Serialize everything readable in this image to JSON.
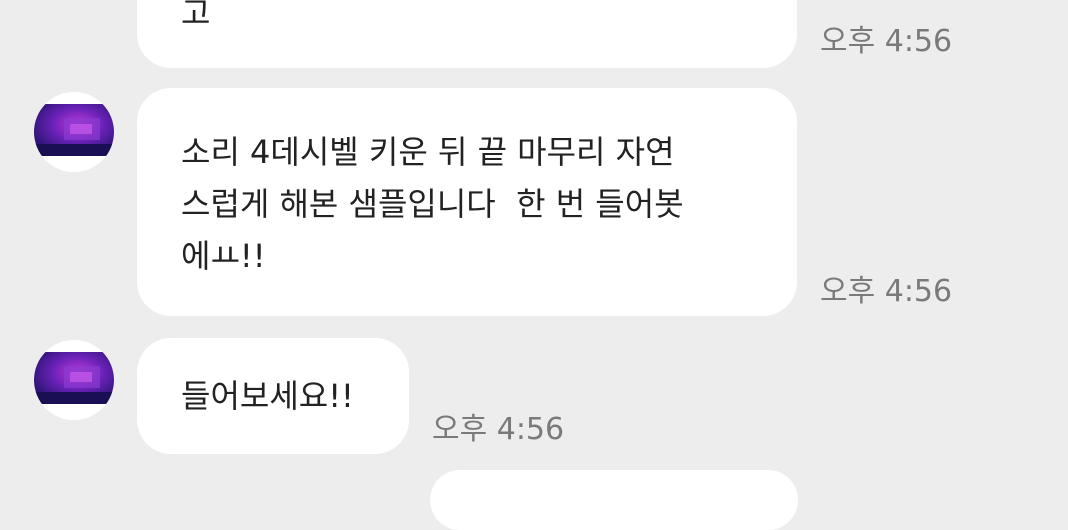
{
  "messages": [
    {
      "text": "고",
      "time": "오후 4:56"
    },
    {
      "text": "소리 4데시벨 키운 뒤 끝 마무리 자연\n스럽게 해본 샘플입니다  한 번 들어봇\n에ㅛ!!",
      "time": "오후 4:56"
    },
    {
      "text": "들어보세요!!",
      "time": "오후 4:56"
    }
  ],
  "colors": {
    "background": "#ededed",
    "bubble": "#ffffff",
    "text": "#222222",
    "timestamp": "#7a7a7a"
  },
  "icons": {
    "avatar": "profile-photo-icon"
  }
}
